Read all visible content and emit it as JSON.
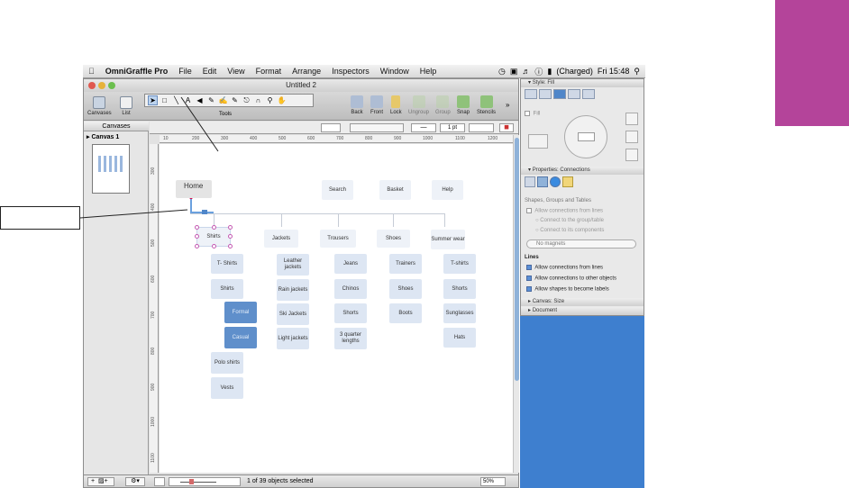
{
  "menubar": {
    "apple_icon": "apple-icon",
    "items": [
      "OmniGraffle Pro",
      "File",
      "Edit",
      "View",
      "Format",
      "Arrange",
      "Inspectors",
      "Window",
      "Help"
    ],
    "battery": "(Charged)",
    "clock": "Fri 15:48"
  },
  "window": {
    "title": "Untitled 2",
    "toolbar": {
      "canvases": "Canvases",
      "list": "List",
      "tools": "Tools",
      "back": "Back",
      "front": "Front",
      "lock": "Lock",
      "ungroup": "Ungroup",
      "group": "Group",
      "snap": "Snap",
      "stencils": "Stencils",
      "stroke_width": "1 pt"
    },
    "sidebar": {
      "header": "Canvases",
      "canvas_item": "Canvas 1"
    },
    "ruler_labels": [
      "10",
      "200",
      "300",
      "400",
      "500",
      "600",
      "700",
      "800",
      "900",
      "1000",
      "1100",
      "1200"
    ],
    "vruler_labels": [
      "300",
      "400",
      "500",
      "600",
      "700",
      "800",
      "900",
      "1000",
      "1100"
    ],
    "status": {
      "selection": "1 of 39 objects selected",
      "zoom": "50%"
    }
  },
  "diagram": {
    "home": "Home",
    "top_links": [
      "Search",
      "Basket",
      "Help"
    ],
    "categories": [
      "Shirts",
      "Jackets",
      "Trousers",
      "Shoes",
      "Summer wear"
    ],
    "shirts": [
      "T- Shirts",
      "Shirts",
      "Formal",
      "Casual",
      "Polo shirts",
      "Vests"
    ],
    "jackets": [
      "Leather jackets",
      "Rain jackets",
      "Ski Jackets",
      "Light jackets"
    ],
    "trousers": [
      "Jeans",
      "Chinos",
      "Shorts",
      "3 quarter lengths"
    ],
    "shoes": [
      "Trainers",
      "Shoes",
      "Boots"
    ],
    "summer": [
      "T-shirts",
      "Shorts",
      "Sunglasses",
      "Hats"
    ]
  },
  "inspector": {
    "style_header": "Style: Fill",
    "fill_label": "Fill",
    "properties_header": "Properties: Connections",
    "section_shapes": "Shapes, Groups and Tables",
    "opt_allow_lines_disabled": "Allow connections from lines",
    "opt_group": "Connect to the group/table",
    "opt_components": "Connect to its components",
    "magnets": "No magnets",
    "lines_header": "Lines",
    "opt_allow_lines": "Allow connections from lines",
    "opt_allow_objects": "Allow connections to other objects",
    "opt_allow_labels": "Allow shapes to become labels",
    "canvas_size": "Canvas: Size",
    "document": "Document"
  },
  "colors": {
    "accent_magenta": "#b4449a",
    "selected_node": "#5f8fcb",
    "node_fill": "#dde6f3",
    "desktop_blue": "#3e7fcf"
  }
}
